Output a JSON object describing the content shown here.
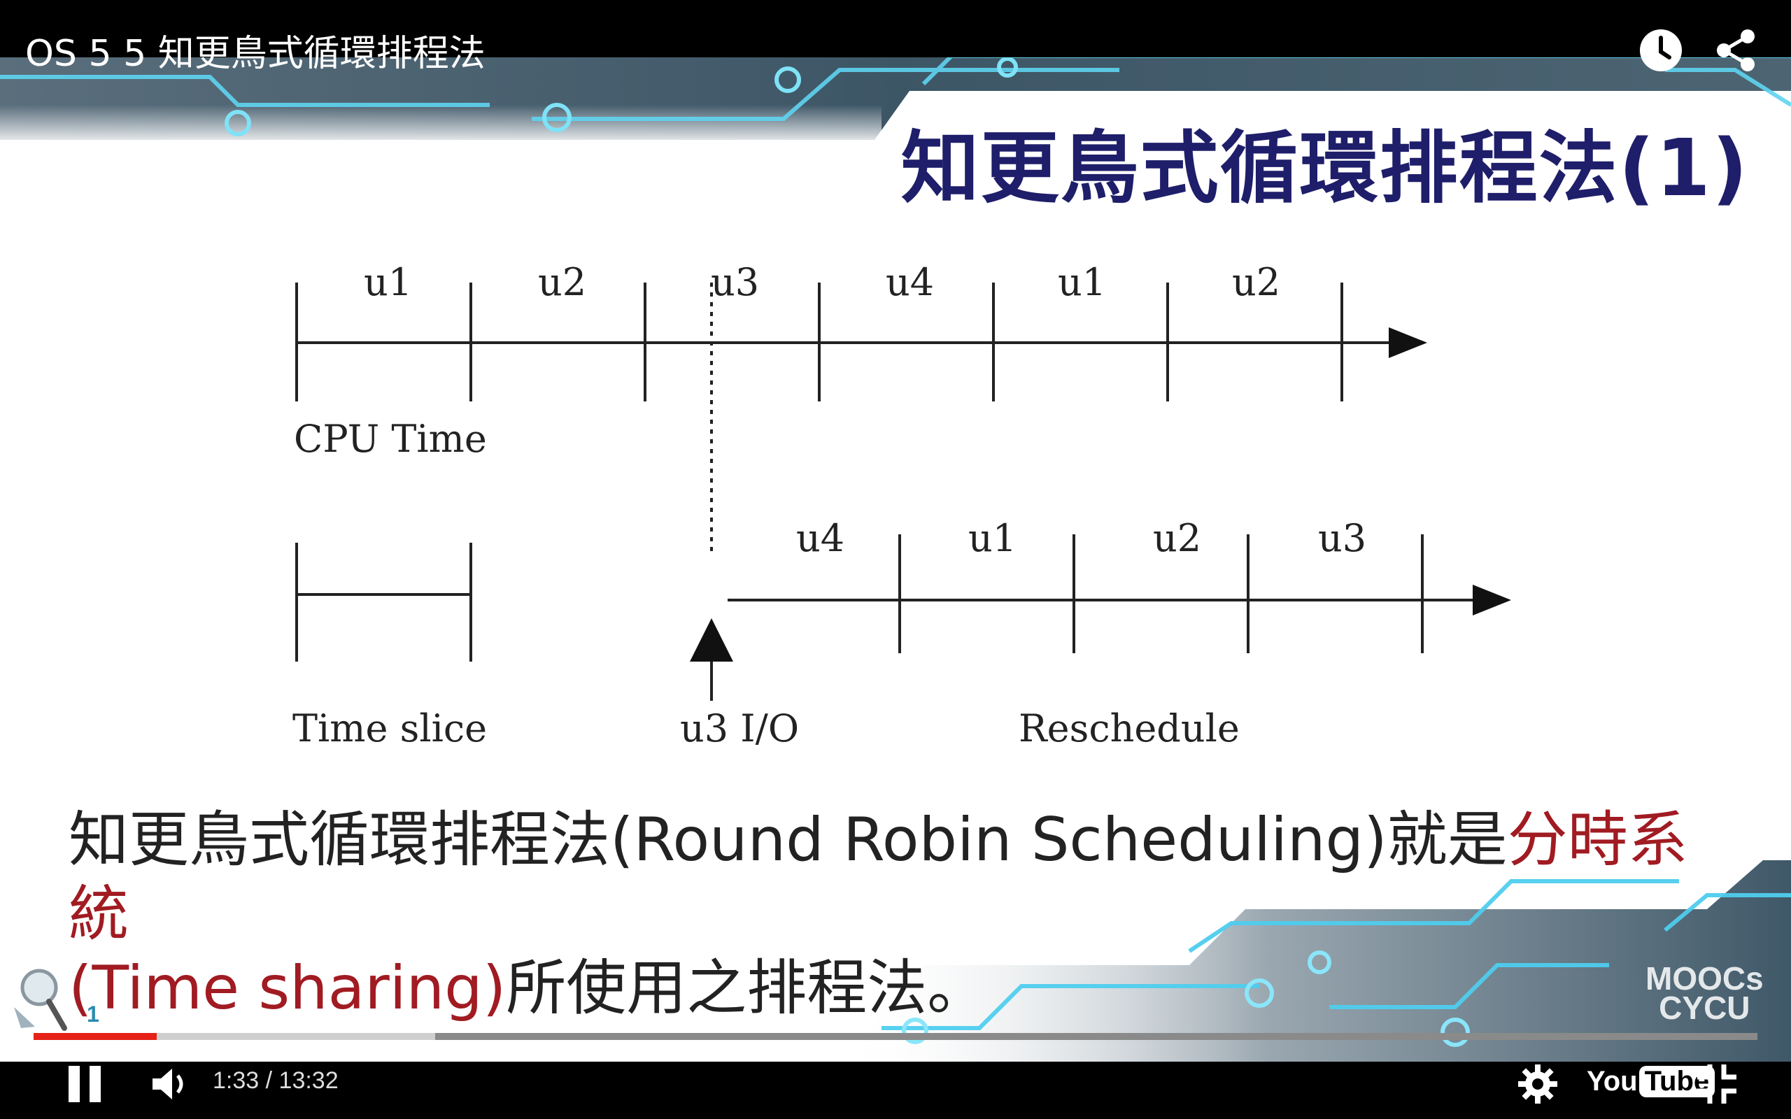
{
  "video": {
    "title": "OS 5 5 知更鳥式循環排程法",
    "progress_played": 0.0715,
    "progress_buffered": 0.233
  },
  "slide": {
    "title": "知更鳥式循環排程法(1)",
    "caption_black_1": "知更鳥式循環排程法(Round Robin Scheduling)就是",
    "caption_red_1": "分時系統",
    "caption_red_2": "(Time sharing)",
    "caption_black_2": "所使用之排程法。",
    "logo_line1": "MOOCs",
    "logo_line2": "CYCU",
    "badge": "1"
  },
  "diagram": {
    "top_slices": [
      "u1",
      "u2",
      "u3",
      "u4",
      "u1",
      "u2"
    ],
    "bottom_slices": [
      "u4",
      "u1",
      "u2",
      "u3"
    ],
    "cpu_time_label": "CPU Time",
    "time_slice_label": "Time slice",
    "io_label": "u3 I/O",
    "reschedule_label": "Reschedule"
  },
  "controls": {
    "current_time": "1:33",
    "separator": "/",
    "duration": "13:32",
    "youtube_you": "You",
    "youtube_tube": "Tube"
  },
  "icons": {
    "watch_later": "clock-icon",
    "share": "share-icon",
    "pause": "pause-icon",
    "volume": "volume-icon",
    "settings": "gear-icon",
    "exit_fullscreen": "exit-fullscreen-icon"
  },
  "colors": {
    "title_color": "#1f1e6a",
    "caption_red": "#a11b22",
    "progress_red": "#e62117"
  }
}
